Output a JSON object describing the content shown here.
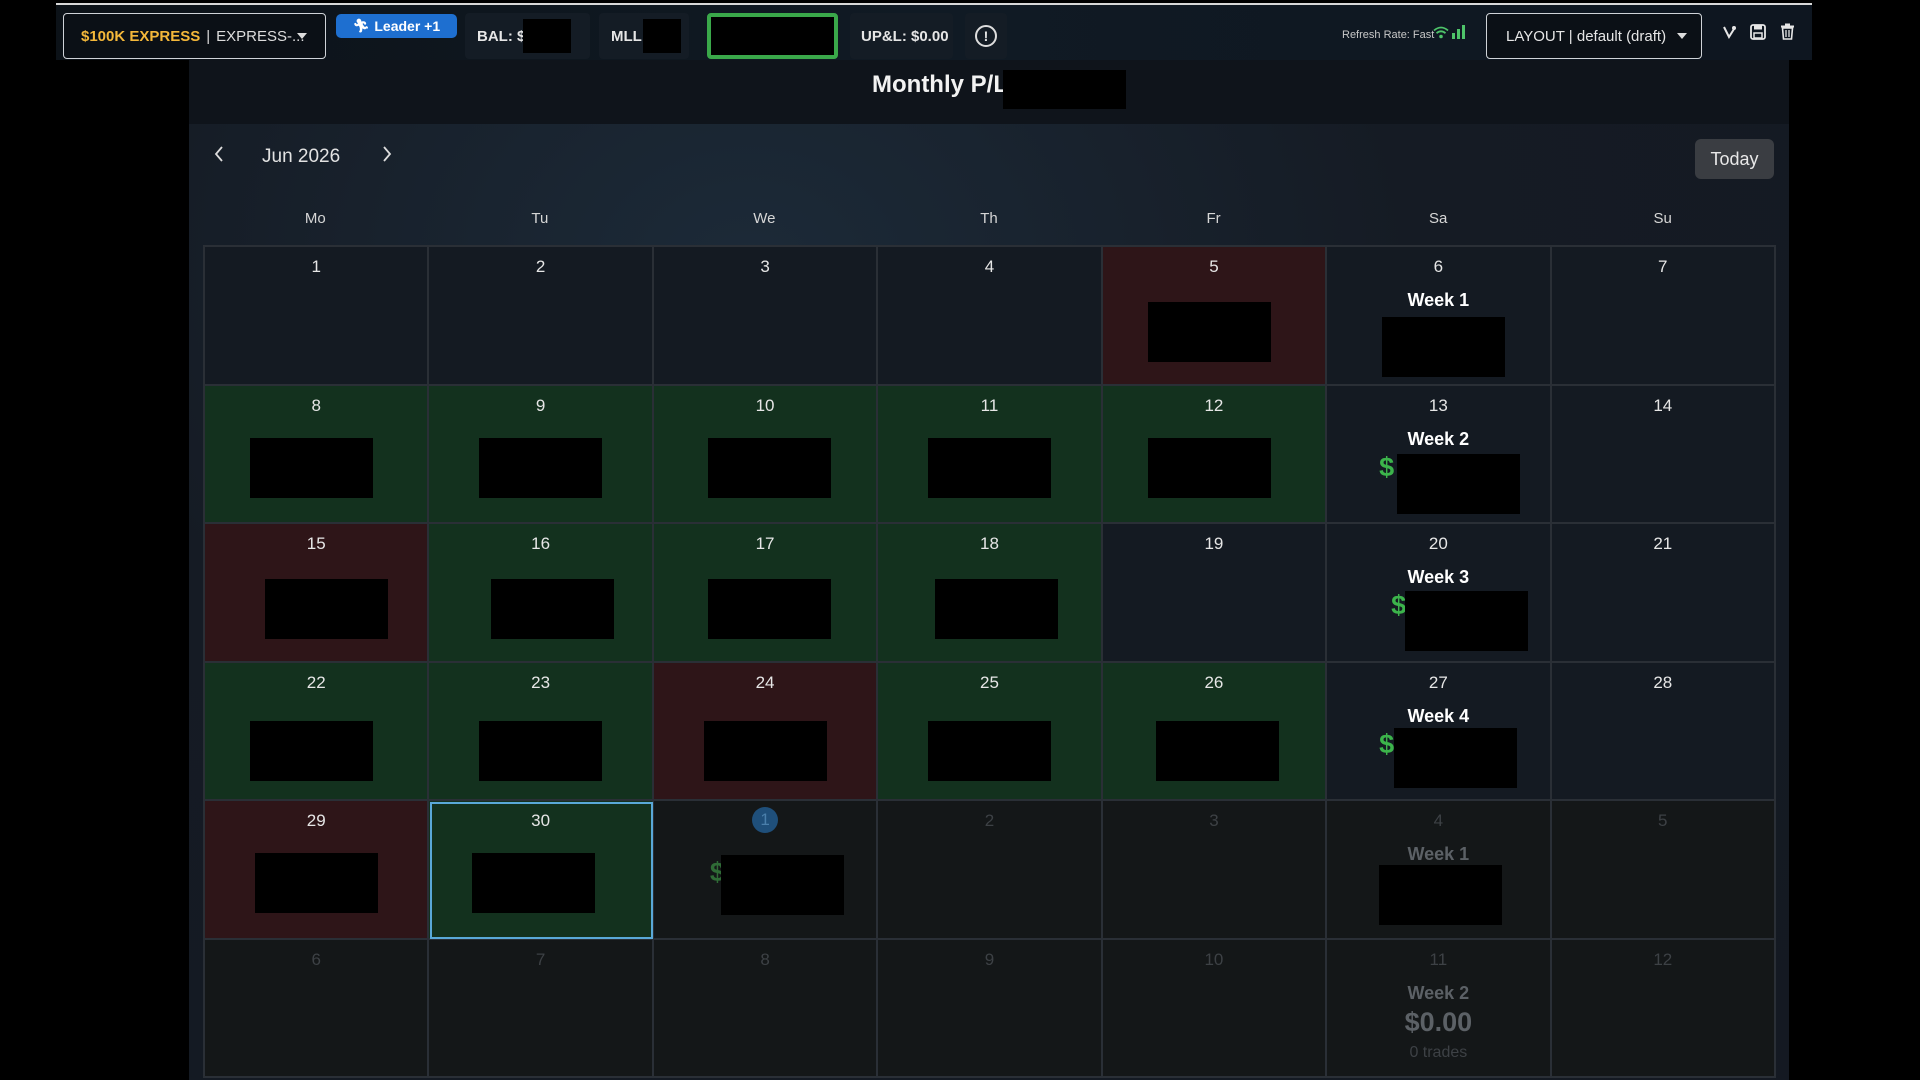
{
  "topbar": {
    "account_name": "$100K EXPRESS",
    "account_sep": "|",
    "account_type": "EXPRESS-...",
    "leader_label": "Leader +1",
    "bal_label": "BAL: $",
    "mll_label": "MLL:",
    "upl_label": "UP&L: $0.00",
    "refresh_label": "Refresh Rate: Fast",
    "layout_label": "LAYOUT | default (draft)"
  },
  "header": {
    "monthly_label": "Monthly P/L:"
  },
  "calendar": {
    "month_label": "Jun 2026",
    "today_label": "Today",
    "weekdays": [
      "Mo",
      "Tu",
      "We",
      "Th",
      "Fr",
      "Sa",
      "Su"
    ],
    "days": [
      {
        "n": "1",
        "status": "flat"
      },
      {
        "n": "2",
        "status": "flat"
      },
      {
        "n": "3",
        "status": "flat"
      },
      {
        "n": "4",
        "status": "flat"
      },
      {
        "n": "5",
        "status": "loss",
        "redacted": true
      },
      {
        "n": "6",
        "status": "flat",
        "week": "Week 1",
        "redacted": true
      },
      {
        "n": "7",
        "status": "flat"
      },
      {
        "n": "8",
        "status": "win",
        "redacted": true
      },
      {
        "n": "9",
        "status": "win",
        "redacted": true
      },
      {
        "n": "10",
        "status": "win",
        "redacted": true
      },
      {
        "n": "11",
        "status": "win",
        "redacted": true
      },
      {
        "n": "12",
        "status": "win",
        "redacted": true
      },
      {
        "n": "13",
        "status": "flat",
        "week": "Week 2",
        "dollar": "$",
        "redacted": true
      },
      {
        "n": "14",
        "status": "flat"
      },
      {
        "n": "15",
        "status": "loss",
        "redacted": true
      },
      {
        "n": "16",
        "status": "win",
        "redacted": true
      },
      {
        "n": "17",
        "status": "win",
        "redacted": true
      },
      {
        "n": "18",
        "status": "win",
        "redacted": true
      },
      {
        "n": "19",
        "status": "flat"
      },
      {
        "n": "20",
        "status": "flat",
        "week": "Week 3",
        "dollar": "$",
        "redacted": true
      },
      {
        "n": "21",
        "status": "flat"
      },
      {
        "n": "22",
        "status": "win",
        "redacted": true
      },
      {
        "n": "23",
        "status": "win",
        "redacted": true
      },
      {
        "n": "24",
        "status": "loss",
        "redacted": true
      },
      {
        "n": "25",
        "status": "win",
        "redacted": true
      },
      {
        "n": "26",
        "status": "win",
        "redacted": true
      },
      {
        "n": "27",
        "status": "flat",
        "week": "Week 4",
        "dollar": "$",
        "redacted": true
      },
      {
        "n": "28",
        "status": "flat"
      },
      {
        "n": "29",
        "status": "loss",
        "redacted": true
      },
      {
        "n": "30",
        "status": "win",
        "selected": true,
        "redacted": true
      },
      {
        "n": "1",
        "status": "other",
        "today": true,
        "dollar": "$",
        "redacted": true
      },
      {
        "n": "2",
        "status": "other"
      },
      {
        "n": "3",
        "status": "other"
      },
      {
        "n": "4",
        "status": "other",
        "week": "Week 1",
        "redacted": true
      },
      {
        "n": "5",
        "status": "other"
      },
      {
        "n": "6",
        "status": "other"
      },
      {
        "n": "7",
        "status": "other"
      },
      {
        "n": "8",
        "status": "other"
      },
      {
        "n": "9",
        "status": "other"
      },
      {
        "n": "10",
        "status": "other"
      },
      {
        "n": "11",
        "status": "other",
        "week": "Week 2",
        "amount": "$0.00",
        "trades": "0 trades"
      },
      {
        "n": "12",
        "status": "other"
      }
    ]
  }
}
